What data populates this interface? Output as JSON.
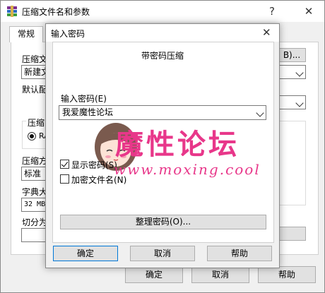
{
  "main_window": {
    "title": "压缩文件名和参数",
    "help_glyph": "?",
    "close_glyph": "✕",
    "tab_general": "常规",
    "archive_name_label": "压缩文",
    "archive_name_value": "新建文",
    "browse_button": "B)...",
    "default_profile_label": "默认配",
    "format_group_label": "压缩",
    "format_radio_label": "RA",
    "method_label": "压缩方",
    "method_value": "标准",
    "dict_label": "字典大",
    "dict_value": "32 MB",
    "split_label": "切分为",
    "ok_button": "确定",
    "cancel_button": "取消",
    "help_button": "帮助"
  },
  "dialog": {
    "title": "输入密码",
    "close_glyph": "✕",
    "heading": "带密码压缩",
    "password_label": "输入密码(E)",
    "password_value": "我爱魔性论坛",
    "show_password_label": "显示密码(S)",
    "show_password_checked": true,
    "encrypt_filenames_label": "加密文件名(N)",
    "encrypt_filenames_checked": false,
    "organize_button": "整理密码(O)...",
    "ok_button": "确定",
    "cancel_button": "取消",
    "help_button": "帮助"
  },
  "watermark": {
    "title": "魔性论坛",
    "url": "www.moxing.cool"
  },
  "colors": {
    "accent_blue": "#0078d7",
    "watermark_pink": "#e8378a"
  }
}
